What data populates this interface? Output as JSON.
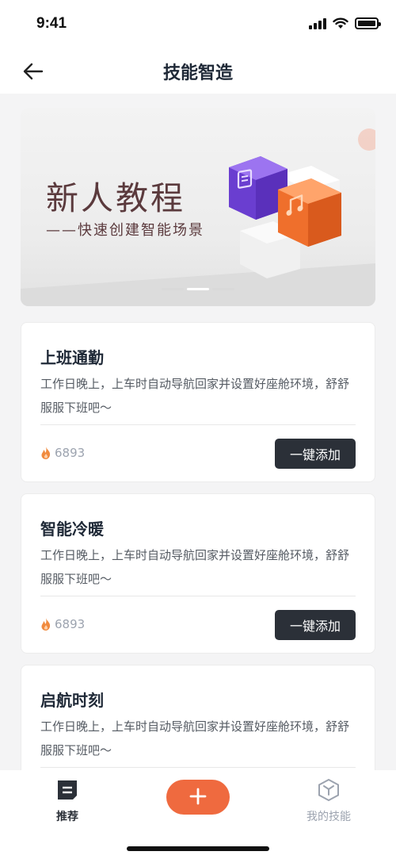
{
  "status_bar": {
    "time": "9:41",
    "icons": [
      "signal-icon",
      "wifi-icon",
      "battery-icon"
    ]
  },
  "header": {
    "title": "技能智造",
    "back_icon": "arrow-left-icon"
  },
  "banner": {
    "title": "新人教程",
    "subtitle": "——快速创建智能场景",
    "icons": [
      "document-icon",
      "music-note-icon"
    ],
    "page_count": 3,
    "active_page": 2
  },
  "cards": [
    {
      "title": "上班通勤",
      "description": "工作日晚上，上车时自动导航回家并设置好座舱环境，舒舒服服下班吧～",
      "count": "6893",
      "button": "一键添加"
    },
    {
      "title": "智能冷暖",
      "description": "工作日晚上，上车时自动导航回家并设置好座舱环境，舒舒服服下班吧～",
      "count": "6893",
      "button": "一键添加"
    },
    {
      "title": "启航时刻",
      "description": "工作日晚上，上车时自动导航回家并设置好座舱环境，舒舒服服下班吧～"
    }
  ],
  "tab_bar": {
    "recommend": "推荐",
    "my_skills": "我的技能",
    "fab_icon": "plus-icon"
  },
  "colors": {
    "accent": "#ef6a3f",
    "dark_button": "#2b3038",
    "flame": "#f08a3e",
    "banner_text": "#5b3a3d",
    "purple_cube": "#7c4fe0",
    "orange_cube": "#f07c3a"
  }
}
